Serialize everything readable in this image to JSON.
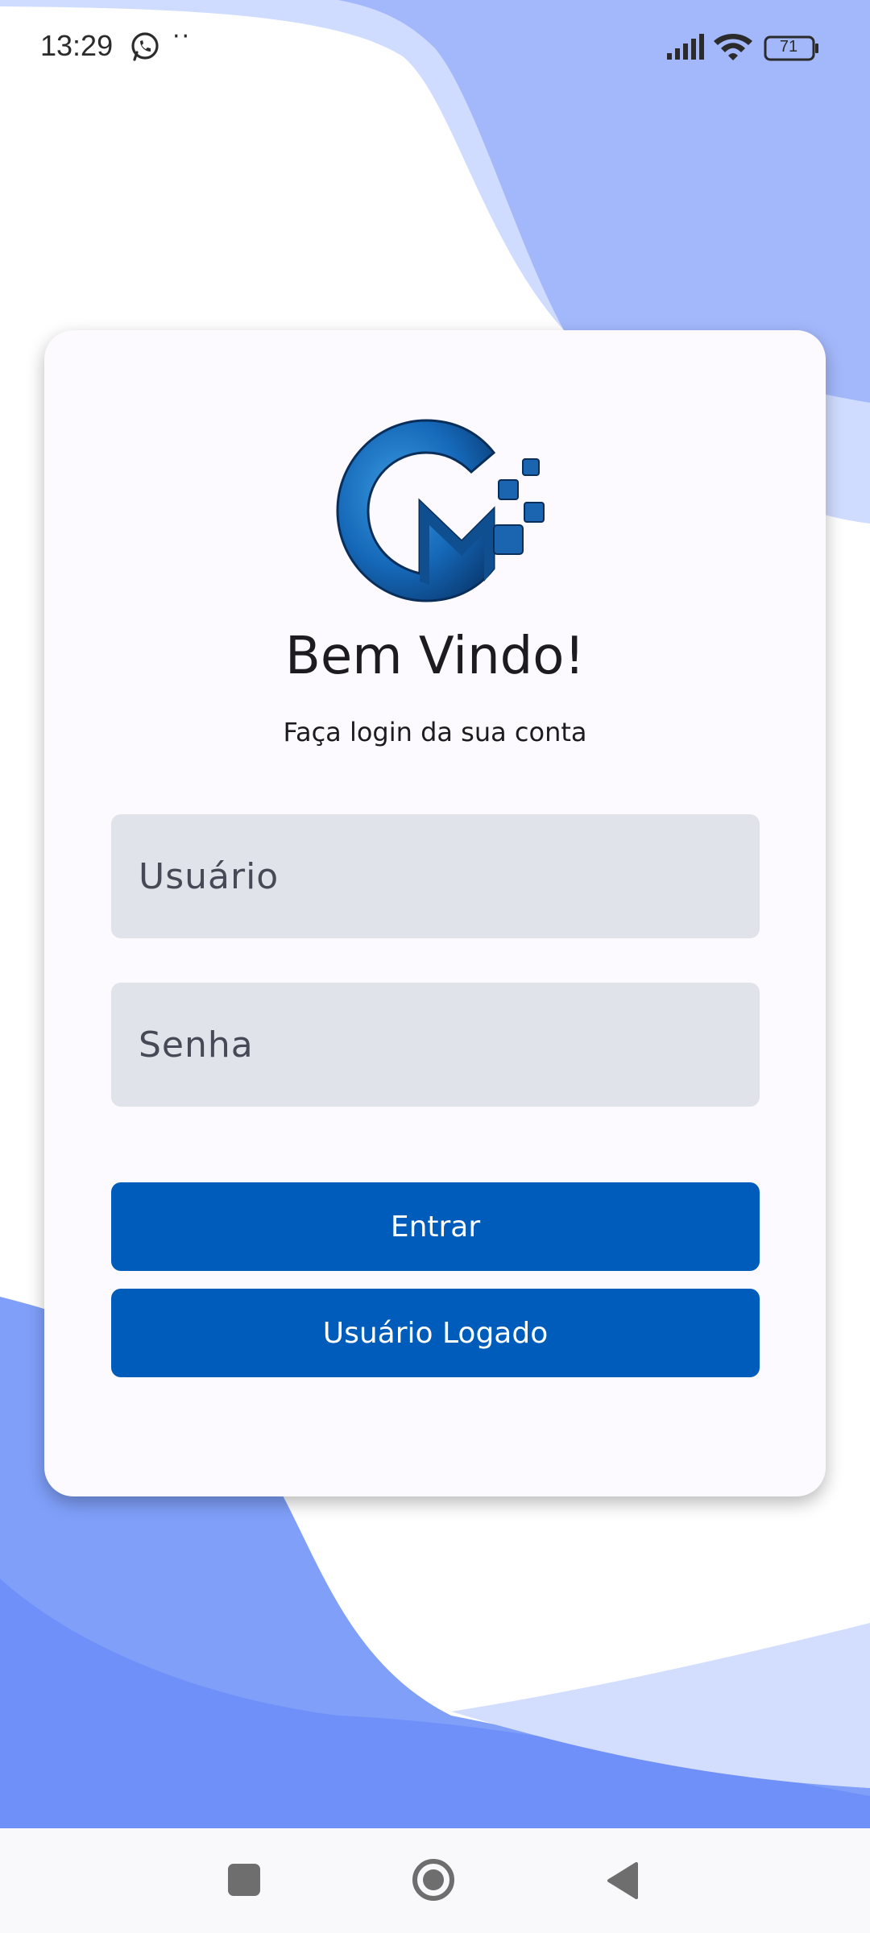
{
  "status_bar": {
    "time": "13:29",
    "notification_icons": [
      "whatsapp-icon"
    ],
    "more_indicator": "··",
    "battery_level": "71",
    "icons": [
      "signal-icon",
      "wifi-icon",
      "battery-icon"
    ]
  },
  "login": {
    "title": "Bem Vindo!",
    "subtitle": "Faça login da sua conta",
    "username_placeholder": "Usuário",
    "password_placeholder": "Senha",
    "enter_label": "Entrar",
    "logged_user_label": "Usuário Logado"
  },
  "colors": {
    "accent": "#005cba",
    "field_background": "#e1e3ea",
    "card_background": "#fcfafe",
    "wave_light": "#cfdbff",
    "wave_mid": "#a4b9fb",
    "wave_deep": "#7494f9"
  },
  "nav": {
    "icons": [
      "recent-apps-icon",
      "home-icon",
      "back-icon"
    ]
  }
}
